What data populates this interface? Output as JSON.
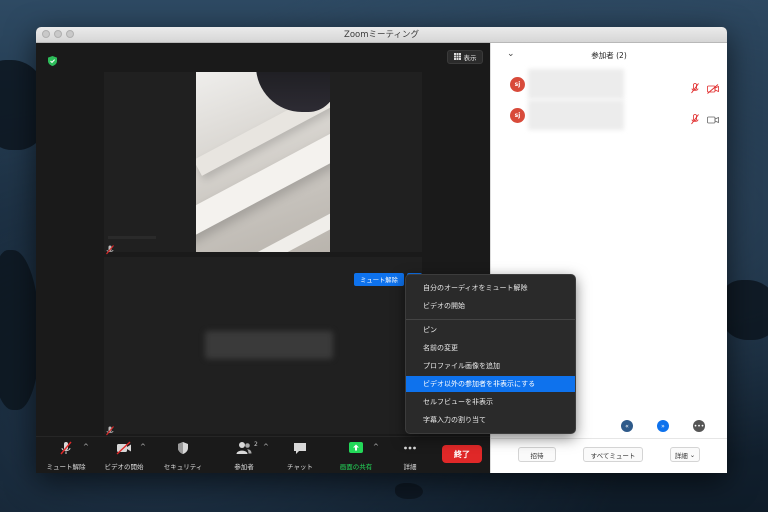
{
  "window": {
    "title": "Zoomミーティング"
  },
  "video": {
    "view_button_label": "表示",
    "unmute_button_label": "ミュート解除",
    "more_button_label": "•••"
  },
  "context_menu": {
    "items": [
      "自分のオーディオをミュート解除",
      "ビデオの開始",
      "ピン",
      "名前の変更",
      "プロファイル画像を追加",
      "ビデオ以外の参加者を非表示にする",
      "セルフビューを非表示",
      "字幕入力の割り当て"
    ],
    "highlighted_index": 5
  },
  "toolbar": {
    "unmute_label": "ミュート解除",
    "start_video_label": "ビデオの開始",
    "security_label": "セキュリティ",
    "participants_label": "参加者",
    "participants_count": "2",
    "chat_label": "チャット",
    "share_label": "画面の共有",
    "more_label": "詳細",
    "end_label": "終了",
    "share_color": "#23d959",
    "end_color": "#e02828"
  },
  "participants_panel": {
    "title": "参加者 (2)",
    "participants": [
      {
        "initials": "sj"
      },
      {
        "initials": "sj"
      }
    ],
    "footer": {
      "invite_label": "招待",
      "mute_all_label": "すべてミュート",
      "details_label": "詳細"
    },
    "avatar_color": "#d84a3a",
    "accent_color": "#0e72ed"
  }
}
